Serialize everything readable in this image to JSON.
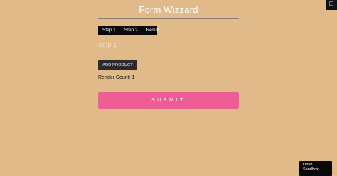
{
  "header": {
    "title": "Form Wizzard"
  },
  "tabs": [
    {
      "label": "Step 1"
    },
    {
      "label": "Step 2"
    },
    {
      "label": "Result"
    }
  ],
  "step": {
    "heading": "Step 1"
  },
  "actions": {
    "add_product_label": "ADD PRODUCT",
    "submit_label": "SUBMIT"
  },
  "render_count": {
    "text": "Render Count: 1"
  },
  "sandbox": {
    "open_line1": "Open",
    "open_line2": "Sandbox"
  },
  "icons": {
    "corner": "corner-toggle-icon"
  },
  "colors": {
    "background": "#e1ba8a",
    "submit": "#ec5e94",
    "tabs_bg": "#0a0a0a",
    "add_button": "#2b2b2b"
  }
}
